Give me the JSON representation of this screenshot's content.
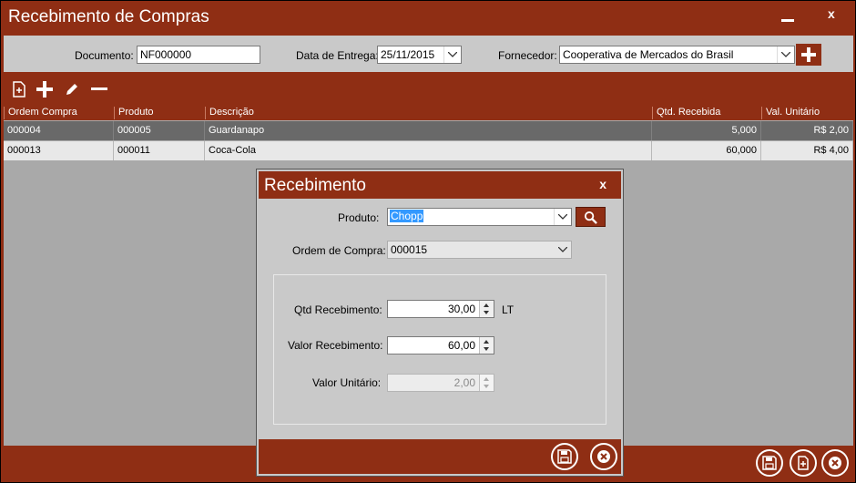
{
  "window": {
    "title": "Recebimento de Compras",
    "minimize_label": "",
    "close_label": "x"
  },
  "filters": {
    "documento_label": "Documento:",
    "documento_value": "NF000000",
    "data_label": "Data de Entrega:",
    "data_value": "25/11/2015",
    "fornecedor_label": "Fornecedor:",
    "fornecedor_value": "Cooperativa de Mercados do Brasil"
  },
  "toolbar": {
    "icons": [
      "new-document-icon",
      "plus-icon",
      "pencil-icon",
      "minus-icon"
    ]
  },
  "grid": {
    "columns": [
      "Ordem Compra",
      "Produto",
      "Descrição",
      "Qtd. Recebida",
      "Val. Unitário"
    ],
    "rows": [
      {
        "ordem": "000004",
        "produto": "000005",
        "descricao": "Guardanapo",
        "qtd": "5,000",
        "valor": "R$ 2,00",
        "selected": true
      },
      {
        "ordem": "000013",
        "produto": "000011",
        "descricao": "Coca-Cola",
        "qtd": "60,000",
        "valor": "R$ 4,00",
        "selected": false
      }
    ]
  },
  "dialog": {
    "title": "Recebimento",
    "close_label": "x",
    "produto_label": "Produto:",
    "produto_value": "Chopp",
    "ordem_label": "Ordem de Compra:",
    "ordem_value": "000015",
    "qtd_label": "Qtd Recebimento:",
    "qtd_value": "30,00",
    "qtd_unit": "LT",
    "valor_label": "Valor Recebimento:",
    "valor_value": "60,00",
    "unitario_label": "Valor Unitário:",
    "unitario_value": "2,00"
  },
  "colors": {
    "brand": "#8f2e14",
    "background": "#c9c9c9",
    "grid_selected": "#696969"
  }
}
